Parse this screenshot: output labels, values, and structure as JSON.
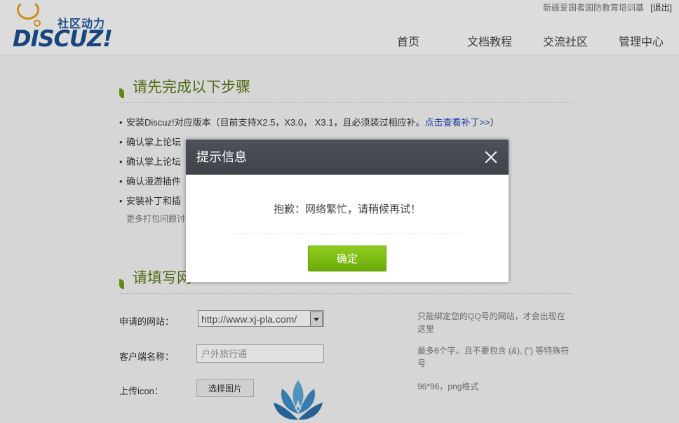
{
  "header": {
    "logo_cn": "社区动力",
    "logo_en": "DISCUZ!",
    "site_user": "新疆爱国者国防教育培训基",
    "logout": "[退出]",
    "nav": [
      "首页",
      "文档教程",
      "交流社区",
      "管理中心"
    ]
  },
  "section1": {
    "title": "请先完成以下步骤",
    "steps": [
      {
        "text": "安装Discuz!对应版本（目前支持X2.5，X3.0，  X3.1，且必须装过相应补。",
        "link": "点击查看补丁>>",
        "tail": "）"
      },
      {
        "text": "确认掌上论坛"
      },
      {
        "text": "确认掌上论坛"
      },
      {
        "text": "确认漫游插件"
      },
      {
        "text": "安装补丁和插"
      }
    ],
    "more": "更多打包问题讨"
  },
  "section2": {
    "title": "请填写网"
  },
  "form": {
    "site_label": "申请的网站：",
    "site_value": "http://www.xj-pla.com/",
    "site_hint": "只能绑定您的QQ号的网站，才会出现在这里",
    "name_label": "客户端名称：",
    "name_placeholder": "户外旅行通",
    "name_hint": "最多6个字。且不要包含 (&), (\") 等特殊符号",
    "icon_label": "上传icon：",
    "icon_button": "选择图片",
    "icon_hint": "96*96，png格式"
  },
  "dialog": {
    "title": "提示信息",
    "message": "抱歉：网络繁忙，请稍候再试！",
    "ok": "确定"
  }
}
